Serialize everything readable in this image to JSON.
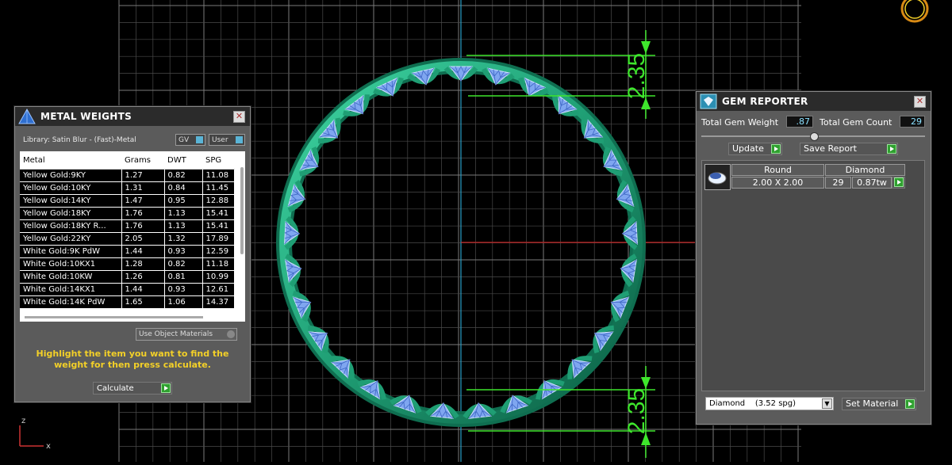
{
  "dimensions": {
    "top": "2.35",
    "bottom": "2.35"
  },
  "axis": {
    "z": "z",
    "x": "x"
  },
  "metal_weights": {
    "title": "METAL WEIGHTS",
    "library": "Library: Satin Blur - (Fast)-Metal",
    "gv_label": "GV",
    "user_label": "User",
    "columns": [
      "Metal",
      "Grams",
      "DWT",
      "SPG"
    ],
    "rows": [
      [
        "Yellow Gold:9KY",
        "1.27",
        "0.82",
        "11.08"
      ],
      [
        "Yellow Gold:10KY",
        "1.31",
        "0.84",
        "11.45"
      ],
      [
        "Yellow Gold:14KY",
        "1.47",
        "0.95",
        "12.88"
      ],
      [
        "Yellow Gold:18KY",
        "1.76",
        "1.13",
        "15.41"
      ],
      [
        "Yellow Gold:18KY R...",
        "1.76",
        "1.13",
        "15.41"
      ],
      [
        "Yellow Gold:22KY",
        "2.05",
        "1.32",
        "17.89"
      ],
      [
        "White Gold:9K PdW",
        "1.44",
        "0.93",
        "12.59"
      ],
      [
        "White Gold:10KX1",
        "1.28",
        "0.82",
        "11.18"
      ],
      [
        "White Gold:10KW",
        "1.26",
        "0.81",
        "10.99"
      ],
      [
        "White Gold:14KX1",
        "1.44",
        "0.93",
        "12.61"
      ],
      [
        "White Gold:14K PdW",
        "1.65",
        "1.06",
        "14.37"
      ]
    ],
    "use_object_materials": "Use Object Materials",
    "hint": "Highlight the item you want to find the weight for then press calculate.",
    "calculate_label": "Calculate"
  },
  "gem_reporter": {
    "title": "GEM REPORTER",
    "total_gem_weight_label": "Total Gem Weight",
    "total_gem_weight_value": ".87",
    "total_gem_count_label": "Total Gem Count",
    "total_gem_count_value": "29",
    "update_label": "Update",
    "save_report_label": "Save Report",
    "gem": {
      "shape": "Round",
      "material": "Diamond",
      "size": "2.00 X 2.00",
      "count": "29",
      "weight": "0.87tw"
    },
    "material_select": "Diamond    (3.52 spg)",
    "set_material_label": "Set Material"
  },
  "colors": {
    "ring": "#1f9e74",
    "gem": "#7fa6f0",
    "dimension": "#3ee62c",
    "accent": "#f3d028"
  }
}
